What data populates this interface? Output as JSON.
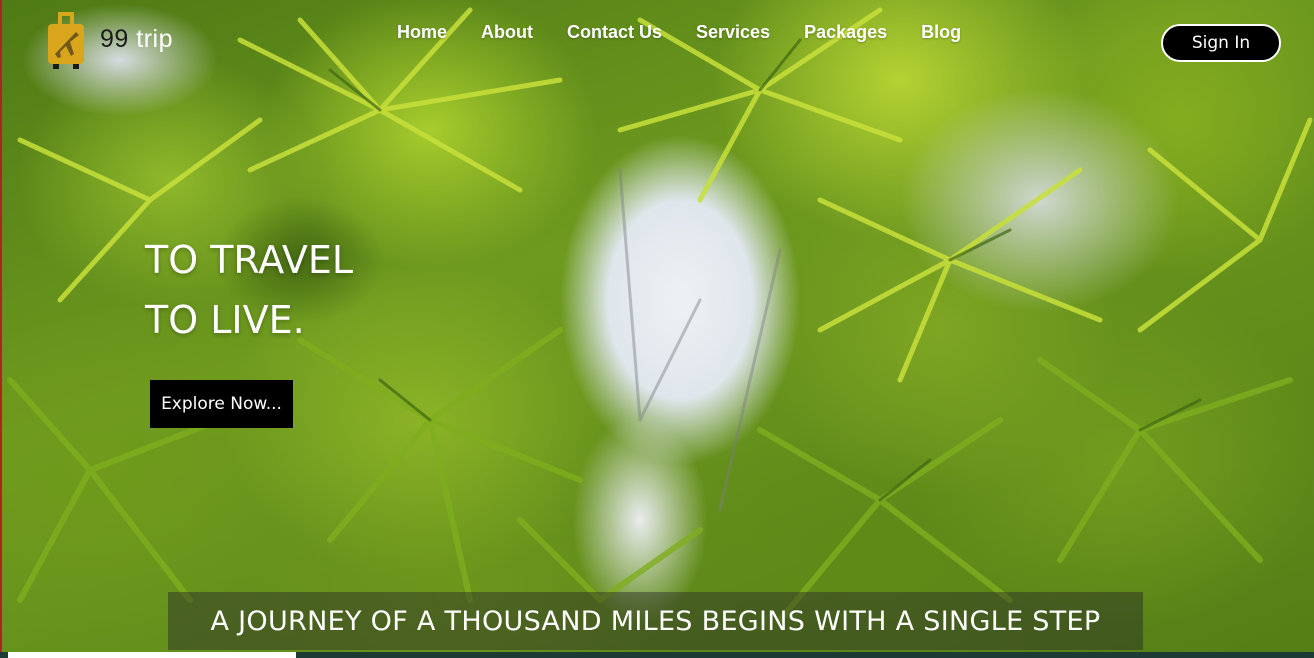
{
  "brand": {
    "logo_icon": "luggage-plane-icon",
    "name_number": "99",
    "name_word": "trip",
    "accent_color": "#d9a51a"
  },
  "nav": {
    "items": [
      "Home",
      "About",
      "Contact Us",
      "Services",
      "Packages",
      "Blog"
    ],
    "signin_label": "Sign In"
  },
  "hero": {
    "headline_line1": "TO TRAVEL",
    "headline_line2": "TO LIVE.",
    "cta_label": "Explore Now...",
    "tagline": "A JOURNEY OF A THOUSAND MILES BEGINS WITH A SINGLE STEP",
    "background": "aerial-palm-trees-beach-image"
  },
  "colors": {
    "button_bg": "#000000",
    "text": "#ffffff"
  }
}
